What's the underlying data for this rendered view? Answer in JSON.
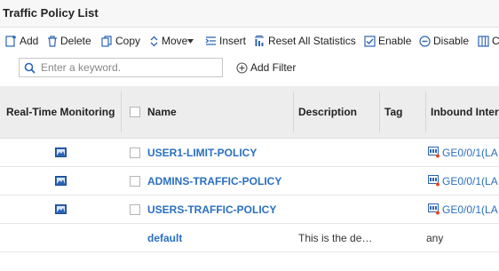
{
  "title": "Traffic Policy List",
  "toolbar": {
    "add": "Add",
    "delete": "Delete",
    "copy": "Copy",
    "move": "Move",
    "insert": "Insert",
    "reset": "Reset All Statistics",
    "enable": "Enable",
    "disable": "Disable",
    "more": "Co"
  },
  "search": {
    "placeholder": "Enter a keyword.",
    "value": ""
  },
  "add_filter": "Add Filter",
  "table": {
    "headers": {
      "monitoring": "Real-Time Monitoring",
      "name": "Name",
      "description": "Description",
      "tag": "Tag",
      "inbound": "Inbound Inter"
    },
    "rows": [
      {
        "name": "USER1-LIMIT-POLICY",
        "description": "",
        "tag": "",
        "inbound": "GE0/0/1(LA",
        "monitor": true,
        "checkbox": true
      },
      {
        "name": "ADMINS-TRAFFIC-POLICY",
        "description": "",
        "tag": "",
        "inbound": "GE0/0/1(LA",
        "monitor": true,
        "checkbox": true
      },
      {
        "name": "USERS-TRAFFIC-POLICY",
        "description": "",
        "tag": "",
        "inbound": "GE0/0/1(LA",
        "monitor": true,
        "checkbox": true
      },
      {
        "name": "default",
        "description": "This is the de…",
        "tag": "",
        "inbound": "any",
        "monitor": false,
        "checkbox": false
      }
    ]
  },
  "colors": {
    "link": "#2a6fc0",
    "header_bg": "#ededed",
    "accent": "#2b63b5"
  }
}
